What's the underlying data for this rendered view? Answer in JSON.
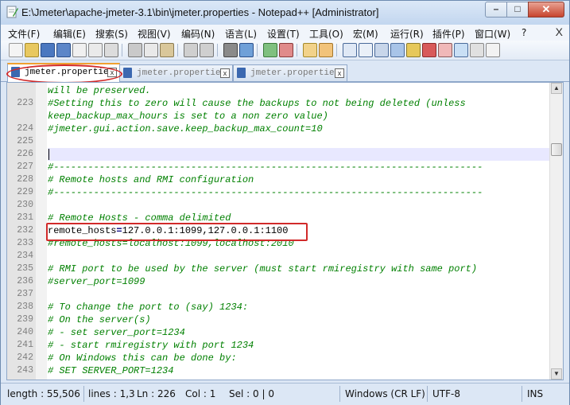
{
  "window": {
    "title": "E:\\Jmeter\\apache-jmeter-3.1\\bin\\jmeter.properties - Notepad++ [Administrator]",
    "minimize": "–",
    "maximize": "□",
    "close": "✕"
  },
  "menu": {
    "items": [
      "文件(F)",
      "编辑(E)",
      "搜索(S)",
      "视图(V)",
      "编码(N)",
      "语言(L)",
      "设置(T)",
      "工具(O)",
      "宏(M)",
      "运行(R)",
      "插件(P)",
      "窗口(W)",
      "?"
    ],
    "close_doc": "X"
  },
  "tabs": [
    {
      "label": "jmeter.properties",
      "active": true,
      "close": "x"
    },
    {
      "label": "jmeter.properties",
      "active": false,
      "close": "x"
    },
    {
      "label": "jmeter.properties",
      "active": false,
      "close": "x"
    }
  ],
  "editor": {
    "lines": [
      {
        "num": "",
        "text": "will be preserved."
      },
      {
        "num": "223",
        "text": "#Setting this to zero will cause the backups to not being deleted (unless"
      },
      {
        "num": "",
        "text": "keep_backup_max_hours is set to a non zero value)"
      },
      {
        "num": "224",
        "text": "#jmeter.gui.action.save.keep_backup_max_count=10"
      },
      {
        "num": "225",
        "text": ""
      },
      {
        "num": "226",
        "text": ""
      },
      {
        "num": "227",
        "text": "#---------------------------------------------------------------------------"
      },
      {
        "num": "228",
        "text": "# Remote hosts and RMI configuration"
      },
      {
        "num": "229",
        "text": "#---------------------------------------------------------------------------"
      },
      {
        "num": "230",
        "text": ""
      },
      {
        "num": "231",
        "text": "# Remote Hosts - comma delimited"
      },
      {
        "num": "232",
        "text": "remote_hosts=127.0.0.1:1099,127.0.0.1:1100"
      },
      {
        "num": "233",
        "text": "#remote_hosts=localhost:1099,localhost:2010"
      },
      {
        "num": "234",
        "text": ""
      },
      {
        "num": "235",
        "text": "# RMI port to be used by the server (must start rmiregistry with same port)"
      },
      {
        "num": "236",
        "text": "#server_port=1099"
      },
      {
        "num": "237",
        "text": ""
      },
      {
        "num": "238",
        "text": "# To change the port to (say) 1234:"
      },
      {
        "num": "239",
        "text": "# On the server(s)"
      },
      {
        "num": "240",
        "text": "# - set server_port=1234"
      },
      {
        "num": "241",
        "text": "# - start rmiregistry with port 1234"
      },
      {
        "num": "242",
        "text": "# On Windows this can be done by:"
      },
      {
        "num": "243",
        "text": "# SET SERVER_PORT=1234"
      }
    ],
    "current_line_index": 5,
    "highlighted_line_index": 11,
    "scrollbar": {
      "up": "▲",
      "down": "▼"
    }
  },
  "status": {
    "length": "length : 55,506",
    "lines": "lines : 1,3",
    "ln": "Ln : 226",
    "col": "Col : 1",
    "sel": "Sel : 0 | 0",
    "eol": "Windows (CR LF)",
    "encoding": "UTF-8",
    "mode": "INS"
  },
  "colors": {
    "comment": "#008000",
    "code": "#000000",
    "operator": "#000080",
    "highlight_box": "#d12a2a",
    "current_line": "#e8e8ff"
  }
}
